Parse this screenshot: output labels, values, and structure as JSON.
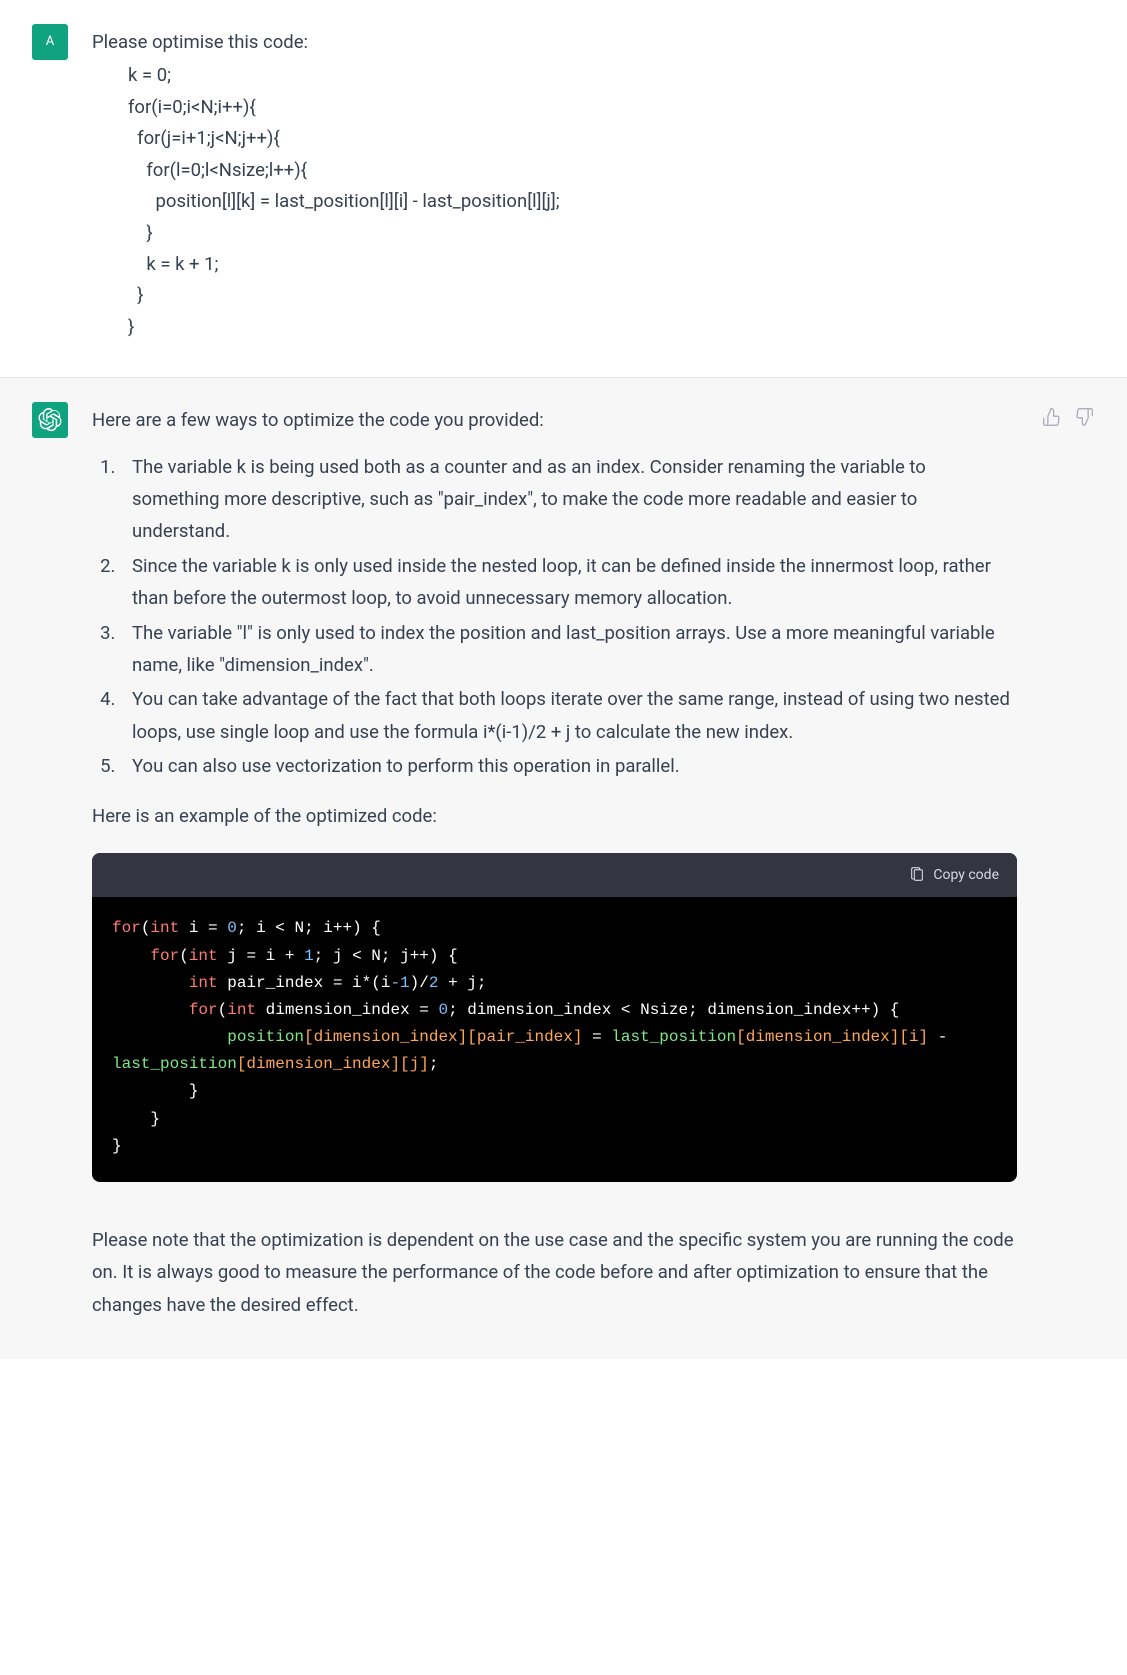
{
  "user": {
    "avatar_letter": "A",
    "prompt_intro": "Please optimise this code:",
    "code_lines": [
      "k = 0;",
      "for(i=0;i<N;i++){",
      "  for(j=i+1;j<N;j++){",
      "    for(l=0;l<Nsize;l++){",
      "      position[l][k] = last_position[l][i] - last_position[l][j];",
      "    }",
      "    k = k + 1;",
      "  }",
      "}"
    ]
  },
  "assistant": {
    "intro": "Here are a few ways to optimize the code you provided:",
    "points": [
      "The variable k is being used both as a counter and as an index. Consider renaming the variable to something more descriptive, such as \"pair_index\", to make the code more readable and easier to understand.",
      "Since the variable k is only used inside the nested loop, it can be defined inside the innermost loop, rather than before the outermost loop, to avoid unnecessary memory allocation.",
      "The variable \"l\" is only used to index the position and last_position arrays. Use a more meaningful variable name, like \"dimension_index\".",
      "You can take advantage of the fact that both loops iterate over the same range, instead of using two nested loops, use single loop and use the formula i*(i-1)/2 + j to calculate the new index.",
      "You can also use vectorization to perform this operation in parallel."
    ],
    "example_label": "Here is an example of the optimized code:",
    "copy_label": "Copy code",
    "code_tokens": [
      [
        {
          "t": "for",
          "c": "kw"
        },
        {
          "t": "(",
          "c": ""
        },
        {
          "t": "int",
          "c": "kw"
        },
        {
          "t": " i = ",
          "c": ""
        },
        {
          "t": "0",
          "c": "num"
        },
        {
          "t": "; i < N; i++) {",
          "c": ""
        }
      ],
      [
        {
          "t": "    ",
          "c": ""
        },
        {
          "t": "for",
          "c": "kw"
        },
        {
          "t": "(",
          "c": ""
        },
        {
          "t": "int",
          "c": "kw"
        },
        {
          "t": " j = i + ",
          "c": ""
        },
        {
          "t": "1",
          "c": "num"
        },
        {
          "t": "; j < N; j++) {",
          "c": ""
        }
      ],
      [
        {
          "t": "        ",
          "c": ""
        },
        {
          "t": "int",
          "c": "kw"
        },
        {
          "t": " pair_index = i*(i",
          "c": ""
        },
        {
          "t": "-1",
          "c": "num"
        },
        {
          "t": ")/",
          "c": ""
        },
        {
          "t": "2",
          "c": "num"
        },
        {
          "t": " + j;",
          "c": ""
        }
      ],
      [
        {
          "t": "        ",
          "c": ""
        },
        {
          "t": "for",
          "c": "kw"
        },
        {
          "t": "(",
          "c": ""
        },
        {
          "t": "int",
          "c": "kw"
        },
        {
          "t": " dimension_index = ",
          "c": ""
        },
        {
          "t": "0",
          "c": "num"
        },
        {
          "t": "; dimension_index < Nsize; dimension_index++) {",
          "c": ""
        }
      ],
      [
        {
          "t": "            ",
          "c": ""
        },
        {
          "t": "position",
          "c": "fn"
        },
        {
          "t": "[dimension_index][pair_index]",
          "c": "br"
        },
        {
          "t": " = ",
          "c": ""
        },
        {
          "t": "last_position",
          "c": "fn"
        },
        {
          "t": "[dimension_index][i]",
          "c": "br"
        },
        {
          "t": " - ",
          "c": ""
        },
        {
          "t": "last_position",
          "c": "fn"
        },
        {
          "t": "[dimension_index][j]",
          "c": "br"
        },
        {
          "t": ";",
          "c": ""
        }
      ],
      [
        {
          "t": "        }",
          "c": ""
        }
      ],
      [
        {
          "t": "    }",
          "c": ""
        }
      ],
      [
        {
          "t": "}",
          "c": ""
        }
      ]
    ],
    "closing": "Please note that the optimization is dependent on the use case and the specific system you are running the code on. It is always good to measure the performance of the code before and after optimization to ensure that the changes have the desired effect."
  }
}
